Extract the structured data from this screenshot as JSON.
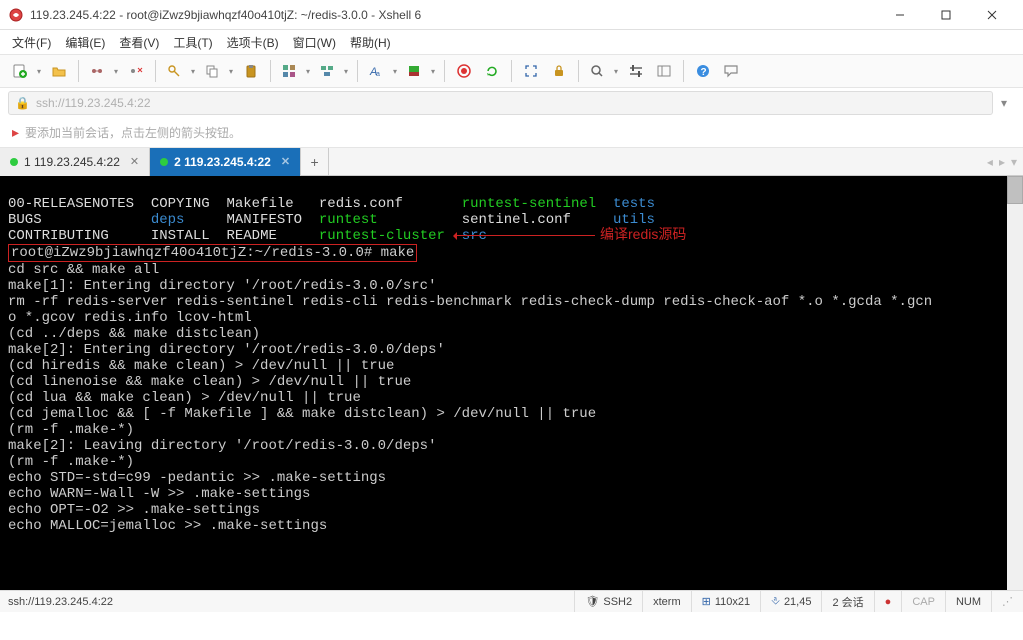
{
  "window": {
    "title": "119.23.245.4:22 - root@iZwz9bjiawhqzf40o410tjZ: ~/redis-3.0.0 - Xshell 6"
  },
  "menu": {
    "file": "文件(F)",
    "edit": "编辑(E)",
    "view": "查看(V)",
    "tools": "工具(T)",
    "tabs": "选项卡(B)",
    "window": "窗口(W)",
    "help": "帮助(H)"
  },
  "address": {
    "url": "ssh://119.23.245.4:22"
  },
  "hint": "要添加当前会话，点击左侧的箭头按钮。",
  "tabs": {
    "tab1": "1 119.23.245.4:22",
    "tab2": "2 119.23.245.4:22"
  },
  "terminal": {
    "ls_col1": [
      "00-RELEASENOTES",
      "BUGS",
      "CONTRIBUTING"
    ],
    "ls_col2": [
      "COPYING",
      "deps",
      "INSTALL"
    ],
    "ls_col3": [
      "Makefile",
      "MANIFESTO",
      "README"
    ],
    "ls_col4": [
      "redis.conf",
      "runtest",
      "runtest-cluster"
    ],
    "ls_col5": [
      "runtest-sentinel",
      "sentinel.conf",
      "src"
    ],
    "ls_col6": [
      "tests",
      "utils",
      ""
    ],
    "prompt": "root@iZwz9bjiawhqzf40o410tjZ:~/redis-3.0.0#",
    "cmd": "make",
    "annotation": "编译redis源码",
    "lines": [
      "cd src && make all",
      "make[1]: Entering directory '/root/redis-3.0.0/src'",
      "rm -rf redis-server redis-sentinel redis-cli redis-benchmark redis-check-dump redis-check-aof *.o *.gcda *.gcn",
      "o *.gcov redis.info lcov-html",
      "(cd ../deps && make distclean)",
      "make[2]: Entering directory '/root/redis-3.0.0/deps'",
      "(cd hiredis && make clean) > /dev/null || true",
      "(cd linenoise && make clean) > /dev/null || true",
      "(cd lua && make clean) > /dev/null || true",
      "(cd jemalloc && [ -f Makefile ] && make distclean) > /dev/null || true",
      "(rm -f .make-*)",
      "make[2]: Leaving directory '/root/redis-3.0.0/deps'",
      "(rm -f .make-*)",
      "echo STD=-std=c99 -pedantic >> .make-settings",
      "echo WARN=-Wall -W >> .make-settings",
      "echo OPT=-O2 >> .make-settings",
      "echo MALLOC=jemalloc >> .make-settings"
    ]
  },
  "status": {
    "left": "ssh://119.23.245.4:22",
    "proto": "SSH2",
    "term": "xterm",
    "size": "110x21",
    "pos": "21,45",
    "sessions": "2 会话",
    "cap": "CAP",
    "num": "NUM"
  }
}
